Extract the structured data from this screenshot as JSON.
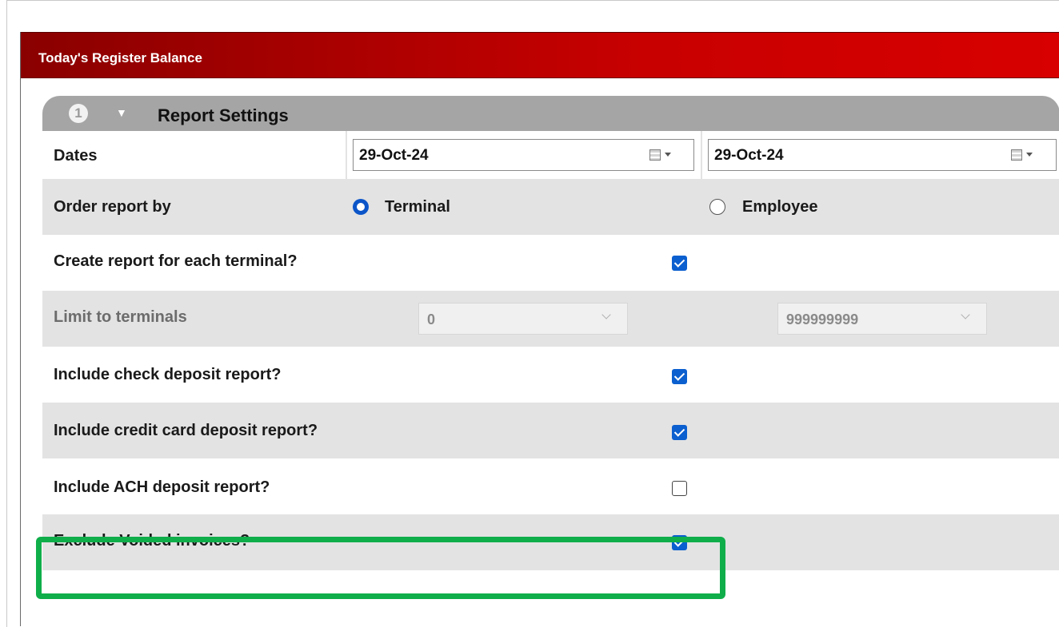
{
  "window": {
    "title": "Today's Register Balance"
  },
  "section": {
    "step": "1",
    "title": "Report Settings",
    "collapse_glyph": "▼"
  },
  "dates": {
    "label": "Dates",
    "from": "29-Oct-24",
    "to": "29-Oct-24"
  },
  "order_by": {
    "label": "Order report by",
    "options": [
      "Terminal",
      "Employee"
    ],
    "selected": "Terminal"
  },
  "create_each": {
    "label": "Create report for each terminal?",
    "checked": true
  },
  "limit_terminals": {
    "label": "Limit to terminals",
    "from": "0",
    "to": "999999999"
  },
  "check_deposit": {
    "label": "Include check deposit report?",
    "checked": true
  },
  "credit_card_deposit": {
    "label": "Include credit card deposit report?",
    "checked": true
  },
  "ach_deposit": {
    "label": "Include ACH deposit report?",
    "checked": false
  },
  "exclude_voided": {
    "label": "Exclude Voided invoices?",
    "checked": true
  },
  "colors": {
    "titlebar": "#c00000",
    "checkbox": "#0b5fcf",
    "highlight": "#0fae4a",
    "row_alt": "#e3e3e3"
  }
}
